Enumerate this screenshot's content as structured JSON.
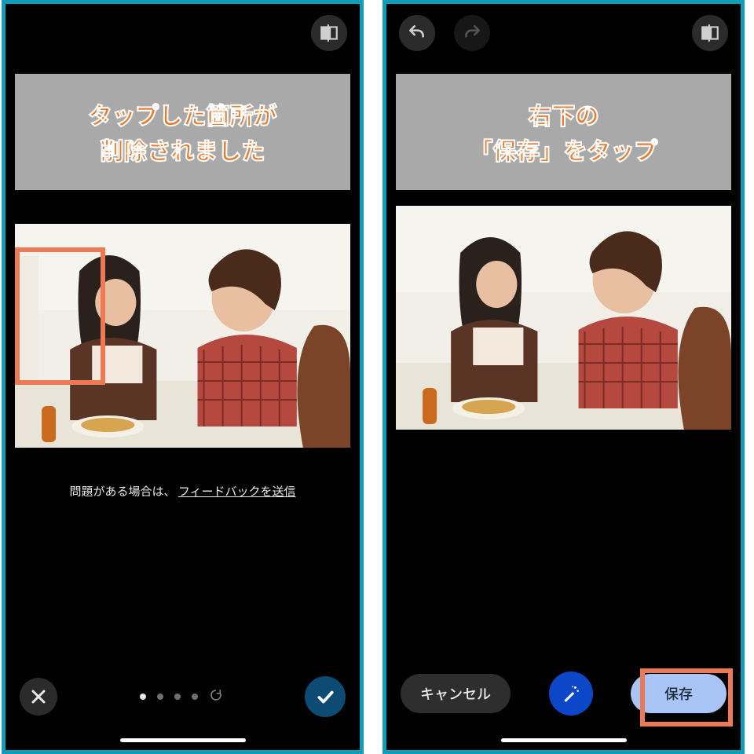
{
  "left": {
    "callout_line1": "タップした箇所が",
    "callout_line2": "削除されました",
    "feedback_prefix": "問題がある場合は、 ",
    "feedback_link": "フィードバックを送信",
    "icons": {
      "compare": "compare-icon",
      "close": "close-icon",
      "refresh": "refresh-icon",
      "confirm": "check-icon"
    }
  },
  "right": {
    "callout_line1": "右下の",
    "callout_line2": "「保存」をタップ",
    "cancel_label": "キャンセル",
    "save_label": "保存",
    "icons": {
      "undo": "undo-icon",
      "redo": "redo-icon",
      "compare": "compare-icon",
      "magic": "magic-wand-icon"
    }
  },
  "colors": {
    "frame": "#0e9eb8",
    "highlight": "#ed7a54",
    "callout_text": "#ec7a2b",
    "primary_blue": "#0d47c9",
    "save_bg": "#a8c5f6"
  }
}
